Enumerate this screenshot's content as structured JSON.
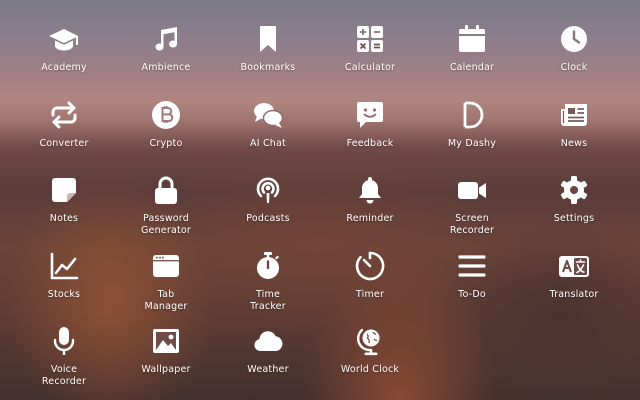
{
  "apps": [
    {
      "label": "Academy",
      "icon": "graduation-cap-icon"
    },
    {
      "label": "Ambience",
      "icon": "music-note-icon"
    },
    {
      "label": "Bookmarks",
      "icon": "bookmark-icon"
    },
    {
      "label": "Calculator",
      "icon": "calculator-icon"
    },
    {
      "label": "Calendar",
      "icon": "calendar-icon"
    },
    {
      "label": "Clock",
      "icon": "clock-icon"
    },
    {
      "label": "Converter",
      "icon": "converter-arrows-icon"
    },
    {
      "label": "Crypto",
      "icon": "bitcoin-icon"
    },
    {
      "label": "AI Chat",
      "icon": "chat-bubbles-icon"
    },
    {
      "label": "Feedback",
      "icon": "feedback-smile-icon"
    },
    {
      "label": "My Dashy",
      "icon": "dashy-d-icon"
    },
    {
      "label": "News",
      "icon": "newspaper-icon"
    },
    {
      "label": "Notes",
      "icon": "sticky-note-icon"
    },
    {
      "label": "Password\nGenerator",
      "icon": "padlock-icon"
    },
    {
      "label": "Podcasts",
      "icon": "podcast-icon"
    },
    {
      "label": "Reminder",
      "icon": "bell-icon"
    },
    {
      "label": "Screen\nRecorder",
      "icon": "video-camera-icon"
    },
    {
      "label": "Settings",
      "icon": "gear-icon"
    },
    {
      "label": "Stocks",
      "icon": "stock-chart-icon"
    },
    {
      "label": "Tab\nManager",
      "icon": "browser-window-icon"
    },
    {
      "label": "Time\nTracker",
      "icon": "stopwatch-icon"
    },
    {
      "label": "Timer",
      "icon": "timer-icon"
    },
    {
      "label": "To-Do",
      "icon": "list-lines-icon"
    },
    {
      "label": "Translator",
      "icon": "translate-icon"
    },
    {
      "label": "Voice\nRecorder",
      "icon": "microphone-icon"
    },
    {
      "label": "Wallpaper",
      "icon": "image-icon"
    },
    {
      "label": "Weather",
      "icon": "cloud-icon"
    },
    {
      "label": "World Clock",
      "icon": "globe-icon"
    }
  ]
}
